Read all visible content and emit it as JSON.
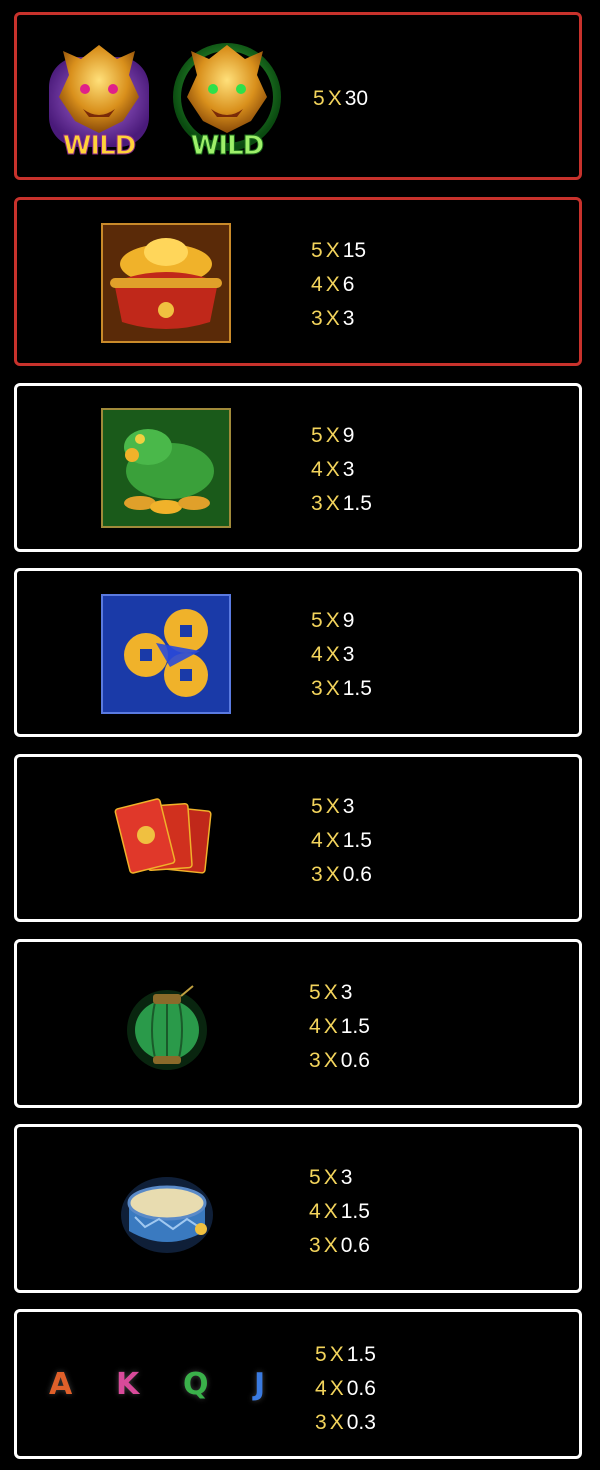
{
  "colors": {
    "highlight_border": "#c8322c",
    "card_border": "#ffffff",
    "multiplier_yellow": "#f3d45c",
    "background": "#000000"
  },
  "paytable": [
    {
      "symbols": [
        "purple-wild-dragon-icon",
        "green-wild-dragon-icon"
      ],
      "symbol_labels": [
        "WILD",
        "WILD"
      ],
      "payouts": [
        {
          "count": "5",
          "x": "X",
          "value": "30"
        }
      ]
    },
    {
      "symbols": [
        "gold-ingot-bowl-icon"
      ],
      "payouts": [
        {
          "count": "5",
          "x": "X",
          "value": "15"
        },
        {
          "count": "4",
          "x": "X",
          "value": "6"
        },
        {
          "count": "3",
          "x": "X",
          "value": "3"
        }
      ]
    },
    {
      "symbols": [
        "money-toad-icon"
      ],
      "payouts": [
        {
          "count": "5",
          "x": "X",
          "value": "9"
        },
        {
          "count": "4",
          "x": "X",
          "value": "3"
        },
        {
          "count": "3",
          "x": "X",
          "value": "1.5"
        }
      ]
    },
    {
      "symbols": [
        "gold-coins-icon"
      ],
      "payouts": [
        {
          "count": "5",
          "x": "X",
          "value": "9"
        },
        {
          "count": "4",
          "x": "X",
          "value": "3"
        },
        {
          "count": "3",
          "x": "X",
          "value": "1.5"
        }
      ]
    },
    {
      "symbols": [
        "red-envelope-icon"
      ],
      "payouts": [
        {
          "count": "5",
          "x": "X",
          "value": "3"
        },
        {
          "count": "4",
          "x": "X",
          "value": "1.5"
        },
        {
          "count": "3",
          "x": "X",
          "value": "0.6"
        }
      ]
    },
    {
      "symbols": [
        "green-lantern-icon"
      ],
      "payouts": [
        {
          "count": "5",
          "x": "X",
          "value": "3"
        },
        {
          "count": "4",
          "x": "X",
          "value": "1.5"
        },
        {
          "count": "3",
          "x": "X",
          "value": "0.6"
        }
      ]
    },
    {
      "symbols": [
        "blue-drum-icon"
      ],
      "payouts": [
        {
          "count": "5",
          "x": "X",
          "value": "3"
        },
        {
          "count": "4",
          "x": "X",
          "value": "1.5"
        },
        {
          "count": "3",
          "x": "X",
          "value": "0.6"
        }
      ]
    },
    {
      "symbols": [
        "letter-a-icon",
        "letter-k-icon",
        "letter-q-icon",
        "letter-j-icon"
      ],
      "symbol_labels": [
        "A",
        "K",
        "Q",
        "J"
      ],
      "payouts": [
        {
          "count": "5",
          "x": "X",
          "value": "1.5"
        },
        {
          "count": "4",
          "x": "X",
          "value": "0.6"
        },
        {
          "count": "3",
          "x": "X",
          "value": "0.3"
        }
      ]
    }
  ]
}
